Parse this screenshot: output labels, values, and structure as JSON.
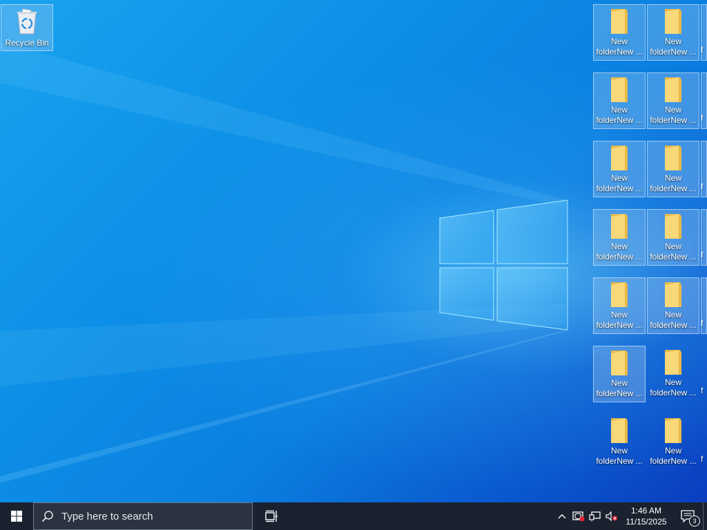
{
  "desktop": {
    "recycle_bin_label": "Recycle Bin",
    "folder_labels": {
      "col1": "New\nfolderNew ...",
      "col2": "New\nfolderNew ...",
      "col3": "f"
    },
    "colors": {
      "folder": "#f8d878",
      "folder_dark": "#e8b94a",
      "selection": "#a0c8f0"
    }
  },
  "taskbar": {
    "search_placeholder": "Type here to search",
    "clock_time": "1:46 AM",
    "clock_date": "11/15/2025",
    "notification_count": "3",
    "icons": [
      "windows-start-icon",
      "search-icon",
      "task-view-icon",
      "chevron-up-icon",
      "security-icon",
      "network-icon",
      "volume-muted-icon",
      "action-center-icon"
    ]
  }
}
